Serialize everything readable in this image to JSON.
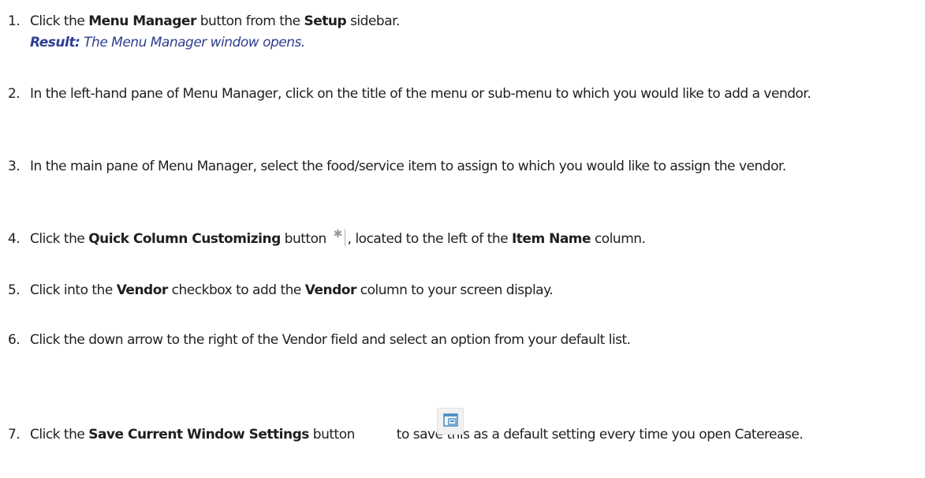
{
  "steps": [
    {
      "num": "1.",
      "pre": "Click the ",
      "b1": "Menu Manager",
      "mid": " button from the ",
      "b2": "Setup",
      "post": " sidebar.",
      "result_label": "Result:",
      "result_text": " The Menu Manager window opens."
    },
    {
      "num": "2.",
      "text": "In the left-hand pane of Menu Manager, click on the title of the menu or sub-menu to which you would like to add a vendor."
    },
    {
      "num": "3.",
      "text": "In the main pane of Menu Manager, select the food/service item to assign to which you would like to assign the vendor."
    },
    {
      "num": "4.",
      "pre": "Click the ",
      "b1": "Quick Column Customizing",
      "mid": " button ",
      "mid2": ", located to the left of the ",
      "b2": "Item Name",
      "post": " column."
    },
    {
      "num": "5.",
      "pre": "Click into the ",
      "b1": "Vendor",
      "mid": " checkbox to add the ",
      "b2": "Vendor",
      "post": " column to your screen display."
    },
    {
      "num": "6.",
      "text": "Click the down arrow to the right of the Vendor field and select an option from your default list."
    },
    {
      "num": "7.",
      "pre": "Click the ",
      "b1": "Save Current Window Settings",
      "mid": " button",
      "post": " to save this as a default setting every time you open Caterease."
    }
  ],
  "icons": {
    "quick_column": "asterisk-column-icon",
    "save_settings": "save-window-settings-icon",
    "accent": "#2f3e8f"
  }
}
